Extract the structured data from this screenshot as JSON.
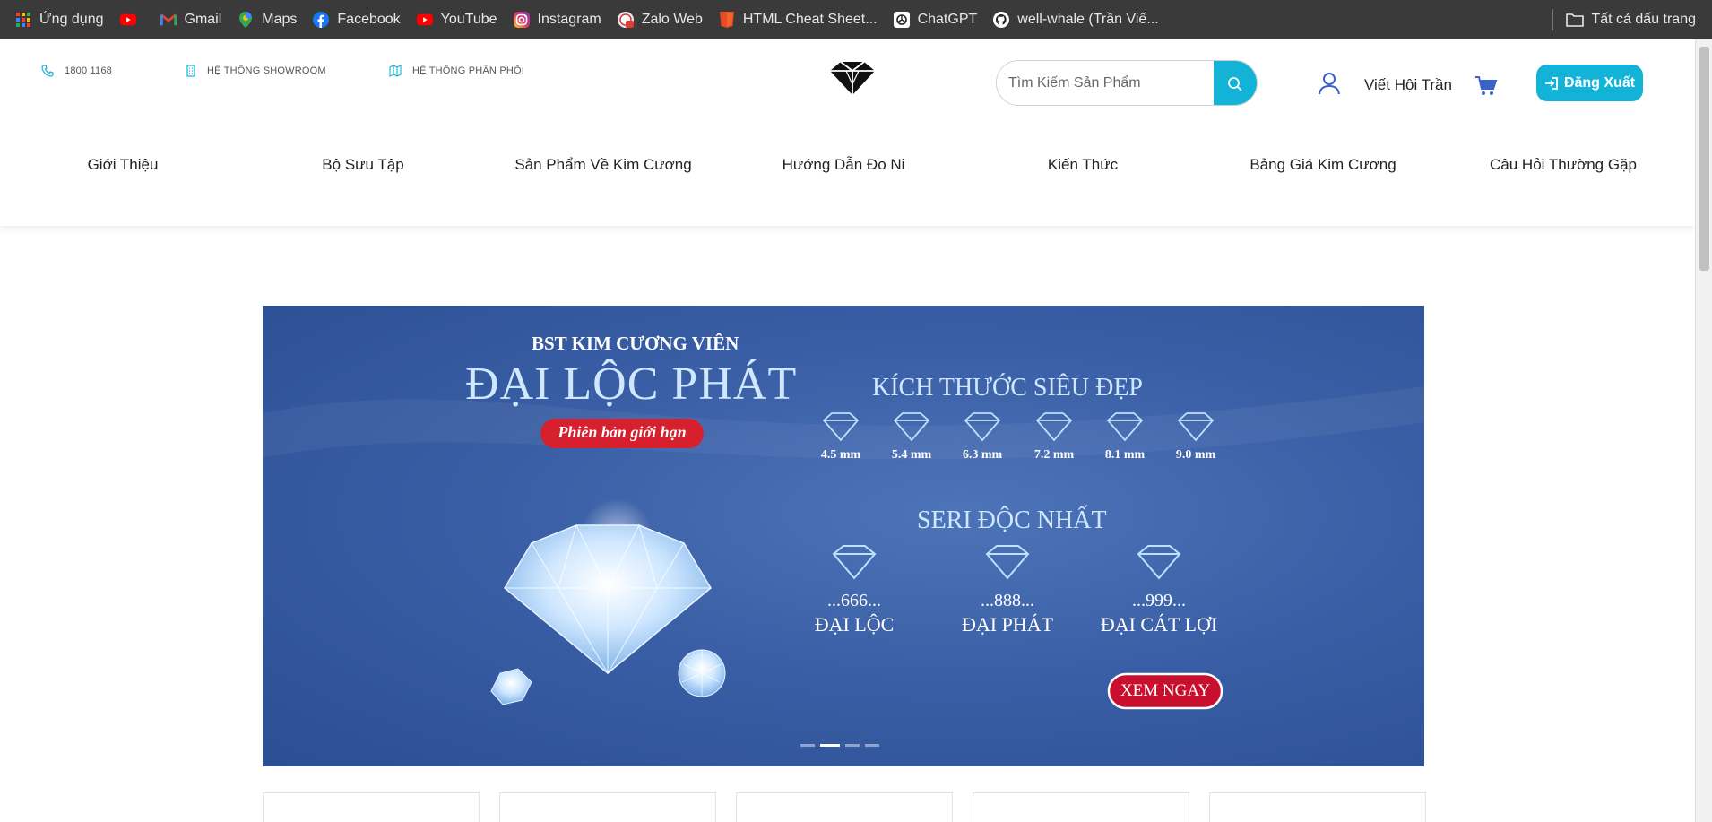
{
  "bookmarks": [
    {
      "label": "Ứng dụng",
      "icon": "apps-grid-icon"
    },
    {
      "label": "",
      "icon": "youtube-icon"
    },
    {
      "label": "Gmail",
      "icon": "gmail-icon"
    },
    {
      "label": "Maps",
      "icon": "maps-pin-icon"
    },
    {
      "label": "Facebook",
      "icon": "facebook-icon"
    },
    {
      "label": "YouTube",
      "icon": "youtube-icon"
    },
    {
      "label": "Instagram",
      "icon": "instagram-icon"
    },
    {
      "label": "Zalo Web",
      "icon": "zalo-icon"
    },
    {
      "label": "HTML Cheat Sheet...",
      "icon": "html5-icon"
    },
    {
      "label": "ChatGPT",
      "icon": "chatgpt-icon"
    },
    {
      "label": "well-whale (Trần Viế...",
      "icon": "github-icon"
    }
  ],
  "all_bookmarks_label": "Tất cả dấu trang",
  "header": {
    "phone": "1800 1168",
    "showroom": "HỆ THỐNG SHOWROOM",
    "distribution": "HỆ THỐNG PHÂN PHỐI",
    "search_placeholder": "Tìm Kiếm Sản Phẩm",
    "user_name": "Viết Hội Trần",
    "logout_label": "Đăng Xuất"
  },
  "nav": [
    "Giới Thiệu",
    "Bộ Sưu Tập",
    "Sản Phẩm Về Kim Cương",
    "Hướng Dẫn Đo Ni",
    "Kiến Thức",
    "Bảng Giá Kim Cương",
    "Câu Hỏi Thường Gặp"
  ],
  "banner": {
    "kicker": "BST KIM CƯƠNG VIÊN",
    "title": "ĐẠI LỘC PHÁT",
    "badge": "Phiên bản giới hạn",
    "sizes_title": "KÍCH THƯỚC SIÊU ĐẸP",
    "sizes": [
      "4.5 mm",
      "5.4 mm",
      "6.3 mm",
      "7.2 mm",
      "8.1 mm",
      "9.0 mm"
    ],
    "series_title": "SERI ĐỘC NHẤT",
    "series": [
      {
        "number": "...666...",
        "name": "ĐẠI LỘC"
      },
      {
        "number": "...888...",
        "name": "ĐẠI PHÁT"
      },
      {
        "number": "...999...",
        "name": "ĐẠI CÁT LỢI"
      }
    ],
    "cta": "XEM NGAY",
    "slides_count": 4,
    "active_slide": 2
  },
  "colors": {
    "accent": "#12b3d6",
    "bookmark_bar": "#3a3a3a",
    "banner_bg": "#3a5fa6",
    "badge_red": "#d6202e"
  }
}
